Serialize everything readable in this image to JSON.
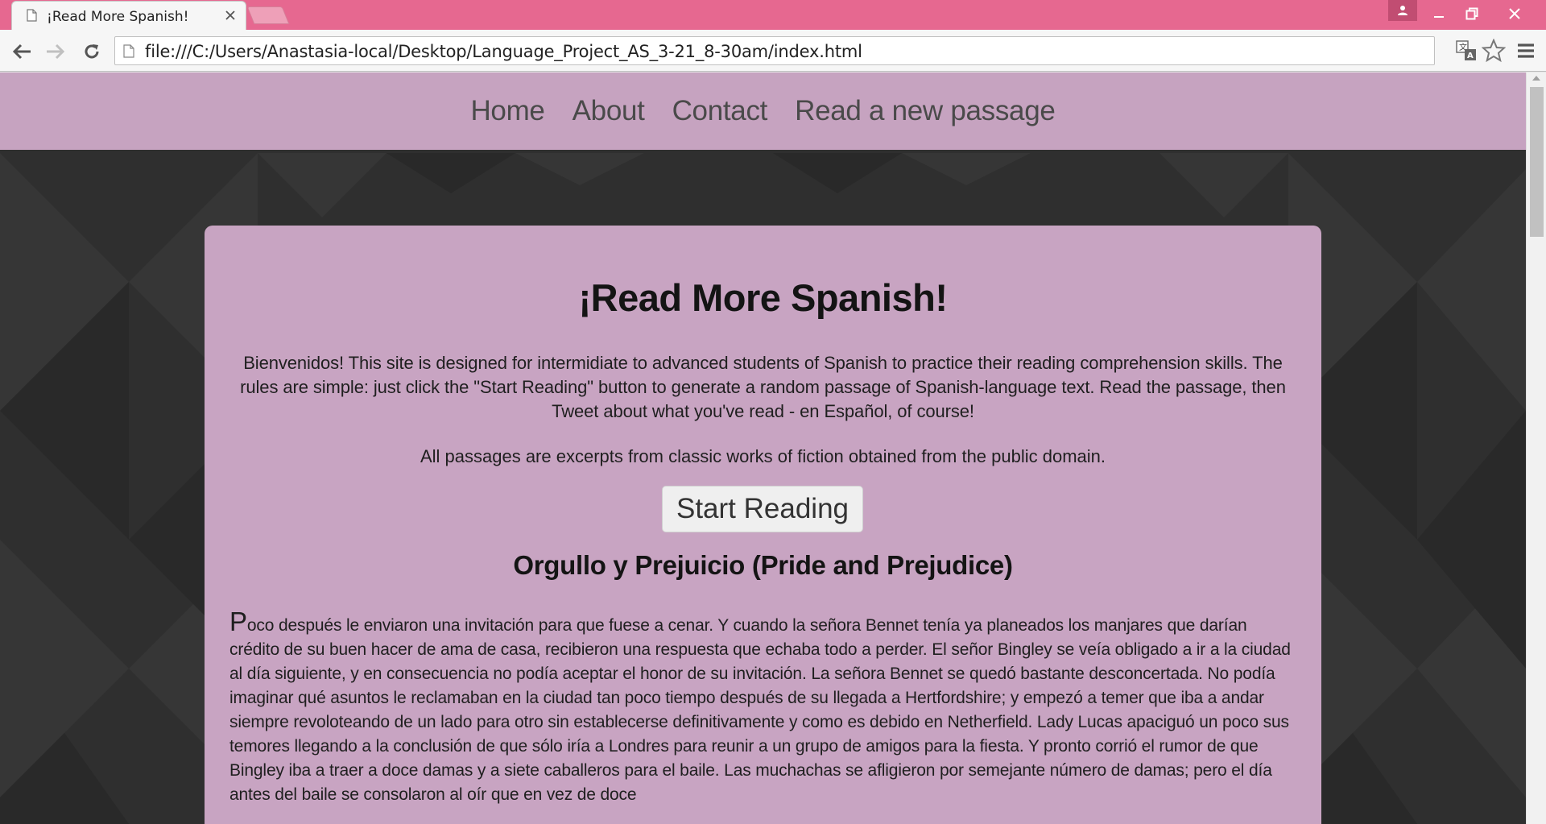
{
  "browser": {
    "tab_title": "¡Read More Spanish!",
    "url": "file:///C:/Users/Anastasia-local/Desktop/Language_Project_AS_3-21_8-30am/index.html",
    "accent_color": "#e66890"
  },
  "nav": {
    "items": [
      {
        "label": "Home"
      },
      {
        "label": "About"
      },
      {
        "label": "Contact"
      },
      {
        "label": "Read a new passage"
      }
    ]
  },
  "main": {
    "title": "¡Read More Spanish!",
    "intro": "Bienvenidos! This site is designed for intermidiate to advanced students of Spanish to practice their reading comprehension skills. The rules are simple: just click the \"Start Reading\" button to generate a random passage of Spanish-language text. Read the passage, then Tweet about what you've read - en Español, of course!",
    "note": "All passages are excerpts from classic works of fiction obtained from the public domain.",
    "start_button": "Start Reading",
    "passage_title": "Orgullo y Prejuicio (Pride and Prejudice)",
    "passage_dropcap": "P",
    "passage_text": "oco después le enviaron una invitación para que fuese a cenar. Y cuando la señora Bennet tenía ya planeados los manjares que darían crédito de su buen hacer de ama de casa, recibieron una respuesta que echaba todo a perder. El señor Bingley se veía obligado a ir a la ciudad al día siguiente, y en consecuencia no podía aceptar el honor de su invitación. La señora Bennet se quedó bastante desconcertada. No podía imaginar qué asuntos le reclamaban en la ciudad tan poco tiempo después de su llegada a Hertfordshire; y empezó a temer que iba a andar siempre revoloteando de un lado para otro sin establecerse definitivamente y como es debido en Netherfield. Lady Lucas apaciguó un poco sus temores llegando a la conclusión de que sólo iría a Londres para reunir a un grupo de amigos para la fiesta. Y pronto corrió el rumor de que Bingley iba a traer a doce damas y a siete caballeros para el baile. Las muchachas se afligieron por semejante número de damas; pero el día antes del baile se consolaron al oír que en vez de doce"
  }
}
